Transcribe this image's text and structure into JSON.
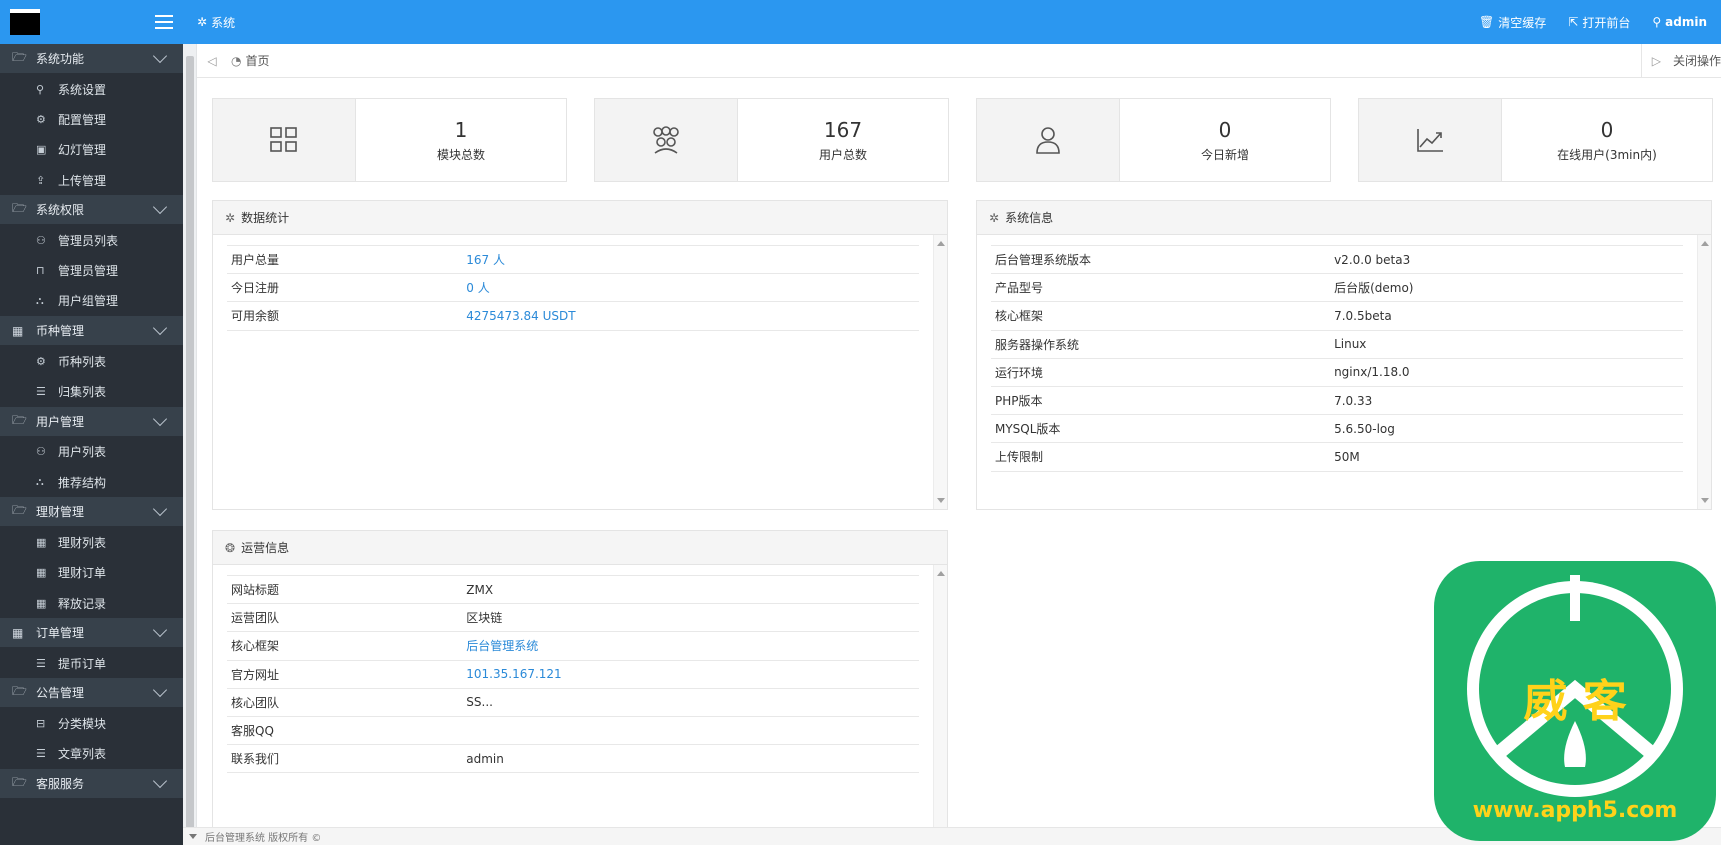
{
  "sidebar": {
    "groups": [
      {
        "title": "系统功能",
        "icon": "folder-icon",
        "items": [
          {
            "label": "系统设置",
            "icon": "wrench-icon"
          },
          {
            "label": "配置管理",
            "icon": "cogs-icon"
          },
          {
            "label": "幻灯管理",
            "icon": "image-icon"
          },
          {
            "label": "上传管理",
            "icon": "upload-icon"
          }
        ]
      },
      {
        "title": "系统权限",
        "icon": "folder-icon",
        "items": [
          {
            "label": "管理员列表",
            "icon": "user-icon"
          },
          {
            "label": "管理员管理",
            "icon": "lock-icon"
          },
          {
            "label": "用户组管理",
            "icon": "sitemap-icon"
          }
        ]
      },
      {
        "title": "币种管理",
        "icon": "grid-icon",
        "items": [
          {
            "label": "币种列表",
            "icon": "cogs-icon"
          },
          {
            "label": "归集列表",
            "icon": "list-icon"
          }
        ]
      },
      {
        "title": "用户管理",
        "icon": "folder-icon",
        "items": [
          {
            "label": "用户列表",
            "icon": "user-icon"
          },
          {
            "label": "推荐结构",
            "icon": "sitemap-icon"
          }
        ]
      },
      {
        "title": "理财管理",
        "icon": "folder-icon",
        "items": [
          {
            "label": "理财列表",
            "icon": "grid-icon"
          },
          {
            "label": "理财订单",
            "icon": "grid-icon"
          },
          {
            "label": "释放记录",
            "icon": "grid-icon"
          }
        ]
      },
      {
        "title": "订单管理",
        "icon": "grid-icon",
        "items": [
          {
            "label": "提币订单",
            "icon": "list-icon"
          }
        ]
      },
      {
        "title": "公告管理",
        "icon": "folder-icon",
        "items": [
          {
            "label": "分类模块",
            "icon": "inbox-icon"
          },
          {
            "label": "文章列表",
            "icon": "list-icon"
          }
        ]
      },
      {
        "title": "客服服务",
        "icon": "folder-icon",
        "items": []
      }
    ]
  },
  "topbar": {
    "crumb": "系统",
    "clear_cache": "清空缓存",
    "open_front": "打开前台",
    "user": "admin"
  },
  "tabs": {
    "home": "首页",
    "close_ops": "关闭操作"
  },
  "stats": [
    {
      "value": "1",
      "label": "模块总数",
      "icon": "grid-icon"
    },
    {
      "value": "167",
      "label": "用户总数",
      "icon": "users-icon"
    },
    {
      "value": "0",
      "label": "今日新增",
      "icon": "user-icon"
    },
    {
      "value": "0",
      "label": "在线用户(3min内)",
      "icon": "line-chart-icon"
    }
  ],
  "data_stats": {
    "title": "数据统计",
    "rows": [
      {
        "k": "用户总量",
        "v": "167 人"
      },
      {
        "k": "今日注册",
        "v": "0 人"
      },
      {
        "k": "可用余额",
        "v": "4275473.84 USDT"
      }
    ]
  },
  "system_info": {
    "title": "系统信息",
    "rows": [
      {
        "k": "后台管理系统版本",
        "v": "v2.0.0 beta3"
      },
      {
        "k": "产品型号",
        "v": "后台版(demo)"
      },
      {
        "k": "核心框架",
        "v": "7.0.5beta"
      },
      {
        "k": "服务器操作系统",
        "v": "Linux"
      },
      {
        "k": "运行环境",
        "v": "nginx/1.18.0"
      },
      {
        "k": "PHP版本",
        "v": "7.0.33"
      },
      {
        "k": "MYSQL版本",
        "v": "5.6.50-log"
      },
      {
        "k": "上传限制",
        "v": "50M"
      }
    ]
  },
  "ops_info": {
    "title": "运营信息",
    "rows": [
      {
        "k": "网站标题",
        "v": "ZMX"
      },
      {
        "k": "运营团队",
        "v": "区块链"
      },
      {
        "k": "核心框架",
        "v": "后台管理系统",
        "link": true
      },
      {
        "k": "官方网址",
        "v": "101.35.167.121",
        "link": true
      },
      {
        "k": "核心团队",
        "v": "SS..."
      },
      {
        "k": "客服QQ",
        "v": ""
      },
      {
        "k": "联系我们",
        "v": "admin"
      }
    ]
  },
  "footer": {
    "text": "后台管理系统 版权所有 ©"
  },
  "watermark": {
    "text": "威 客",
    "url": "www.apph5.com"
  },
  "colors": {
    "brand": "#2b97f0",
    "sidebar": "#2a3038",
    "link": "#2b8ad8"
  }
}
